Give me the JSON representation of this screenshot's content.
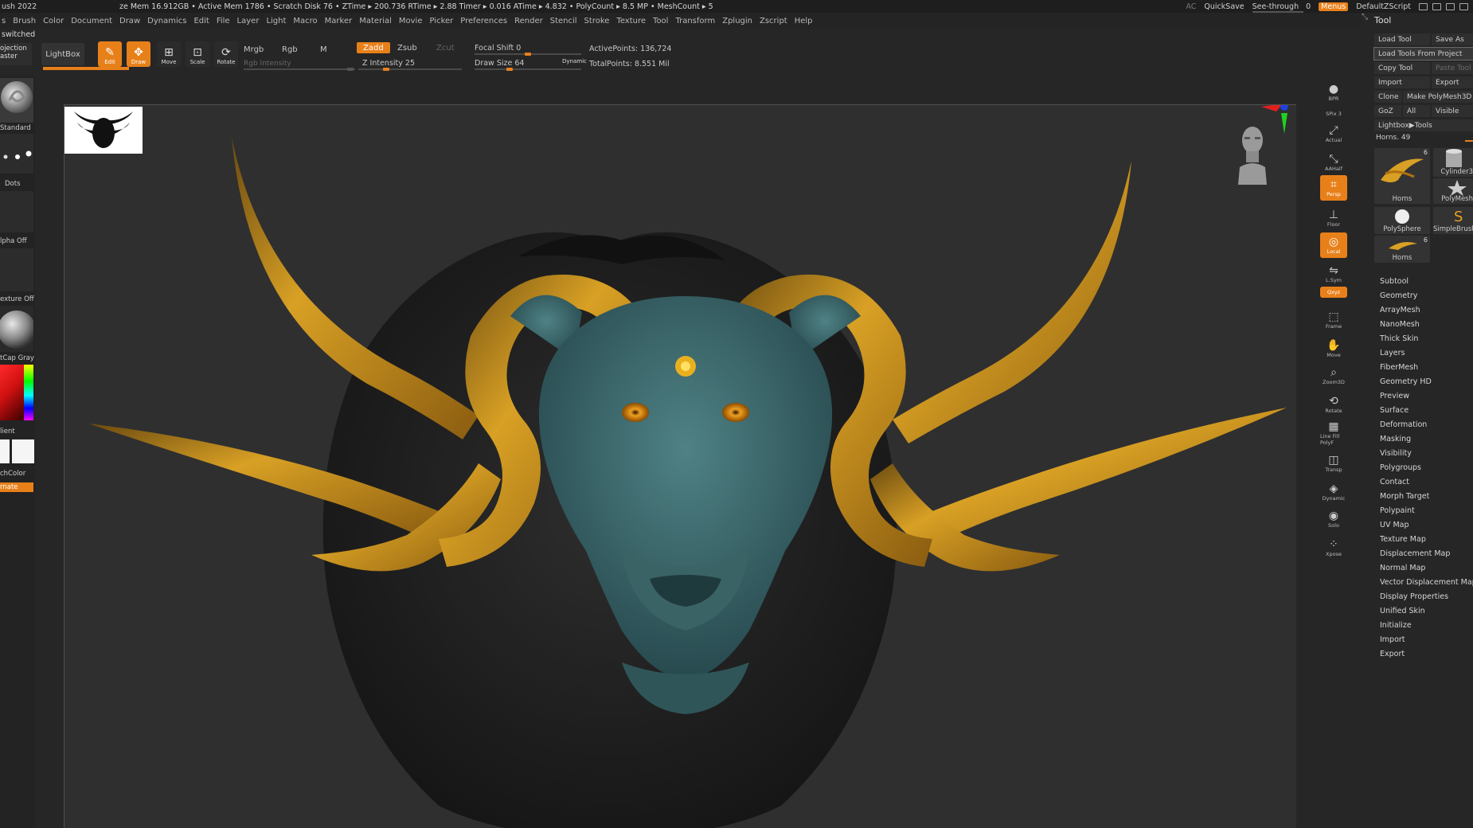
{
  "titlebar": {
    "app": "ush 2022",
    "stats": "ze Mem 16.912GB • Active Mem 1786 • Scratch Disk 76 • ZTime ▸ 200.736 RTime ▸ 2.88 Timer ▸ 0.016 ATime ▸ 4.832 • PolyCount ▸ 8.5 MP • MeshCount ▸ 5",
    "ac": "AC",
    "quicksave": "QuickSave",
    "see_through": "See-through",
    "see_through_value": "0",
    "see_through_fraction": 0,
    "menus": "Menus",
    "script": "DefaultZScript",
    "accent_color": "#e8801a"
  },
  "menubar": [
    "s",
    "Brush",
    "Color",
    "Document",
    "Draw",
    "Dynamics",
    "Edit",
    "File",
    "Layer",
    "Light",
    "Macro",
    "Marker",
    "Material",
    "Movie",
    "Picker",
    "Preferences",
    "Render",
    "Stencil",
    "Stroke",
    "Texture",
    "Tool",
    "Transform",
    "Zplugin",
    "Zscript",
    "Help"
  ],
  "notice": "switched",
  "toolbar": {
    "projection": "ojection",
    "projection2": "aster",
    "lightbox": "LightBox",
    "edit": "Edit",
    "draw": "Draw",
    "move": "Move",
    "scale": "Scale",
    "rotate": "Rotate",
    "mrgb": "Mrgb",
    "rgb": "Rgb",
    "m": "M",
    "rgb_intensity": "Rgb Intensity",
    "zadd": "Zadd",
    "zsub": "Zsub",
    "zcut": "Zcut",
    "z_intensity": "Z Intensity 25",
    "z_intensity_fraction": 0.25,
    "focal_shift": "Focal Shift 0",
    "focal_shift_fraction": 0.5,
    "draw_size": "Draw Size 64",
    "draw_size_fraction": 0.32,
    "dynamic": "Dynamic",
    "active_points": "ActivePoints: 136,724",
    "total_points": "TotalPoints: 8.551 Mil"
  },
  "leftshelf": {
    "brush": "Standard",
    "stroke": "Dots",
    "alpha": "lpha Off",
    "texture": "exture Off",
    "material": "tCap Gray",
    "gradient": "lient",
    "switch_color": "chColor",
    "alternate": "rnate"
  },
  "rightstrip": [
    {
      "name": "bpr",
      "label": "BPR",
      "icon": "sphere-icon",
      "on": false
    },
    {
      "name": "spix",
      "label": "SPix 3",
      "icon": "",
      "on": false
    },
    {
      "name": "actual",
      "label": "Actual",
      "icon": "actual-icon",
      "on": false
    },
    {
      "name": "aahalf",
      "label": "AAHalf",
      "icon": "aahalf-icon",
      "on": false
    },
    {
      "name": "persp",
      "label": "Persp",
      "icon": "persp-icon",
      "on": true
    },
    {
      "name": "floor",
      "label": "Floor",
      "icon": "floor-icon",
      "on": false
    },
    {
      "name": "local",
      "label": "Local",
      "icon": "local-icon",
      "on": true
    },
    {
      "name": "lsym",
      "label": "L.Sym",
      "icon": "lsym-icon",
      "on": false
    },
    {
      "name": "xyz",
      "label": "Qxyz",
      "icon": "",
      "on": true
    },
    {
      "name": "frame",
      "label": "Frame",
      "icon": "frame-icon",
      "on": false
    },
    {
      "name": "move",
      "label": "Move",
      "icon": "move-icon",
      "on": false
    },
    {
      "name": "zoom3d",
      "label": "Zoom3D",
      "icon": "zoom-icon",
      "on": false
    },
    {
      "name": "rotate",
      "label": "Rotate",
      "icon": "rotate-icon",
      "on": false
    },
    {
      "name": "linefill",
      "label": "Line Fill PolyF",
      "icon": "polyf-icon",
      "on": false
    },
    {
      "name": "transp",
      "label": "Transp",
      "icon": "transp-icon",
      "on": false
    },
    {
      "name": "dynamic",
      "label": "Dynamic",
      "icon": "ghost-icon",
      "on": false
    },
    {
      "name": "solo",
      "label": "Solo",
      "icon": "solo-icon",
      "on": false
    },
    {
      "name": "xpose",
      "label": "Xpose",
      "icon": "xpose-icon",
      "on": false
    }
  ],
  "toolpalette": {
    "title": "Tool",
    "load_tool": "Load Tool",
    "save_as": "Save As",
    "load_tools_from_project": "Load Tools From Project",
    "copy_tool": "Copy Tool",
    "paste_tool": "Paste Tool",
    "import": "Import",
    "export": "Export",
    "clone": "Clone",
    "make_polymesh": "Make PolyMesh3D",
    "goz": "GoZ",
    "all": "All",
    "visible": "Visible",
    "lightbox_tools": "Lightbox▶Tools",
    "current_tool": "Horns. 49",
    "thumbs": [
      {
        "caption": "Horns",
        "count": "6"
      },
      {
        "caption": "Cylinder3"
      },
      {
        "caption": "PolyMesh"
      },
      {
        "caption": "PolySphere"
      },
      {
        "caption": "SimpleBrush"
      },
      {
        "caption": "Horns",
        "count": "6"
      }
    ],
    "menus": [
      "Subtool",
      "Geometry",
      "ArrayMesh",
      "NanoMesh",
      "Thick Skin",
      "Layers",
      "FiberMesh",
      "Geometry HD",
      "Preview",
      "Surface",
      "Deformation",
      "Masking",
      "Visibility",
      "Polygroups",
      "Contact",
      "Morph Target",
      "Polypaint",
      "UV Map",
      "Texture Map",
      "Displacement Map",
      "Normal Map",
      "Vector Displacement Map",
      "Display Properties",
      "Unified Skin",
      "Initialize",
      "Import",
      "Export"
    ]
  },
  "colors": {
    "horn": "#c99420",
    "skin": "#3f6b6e",
    "fur": "#1c1c1c",
    "eye": "#f0a020"
  }
}
